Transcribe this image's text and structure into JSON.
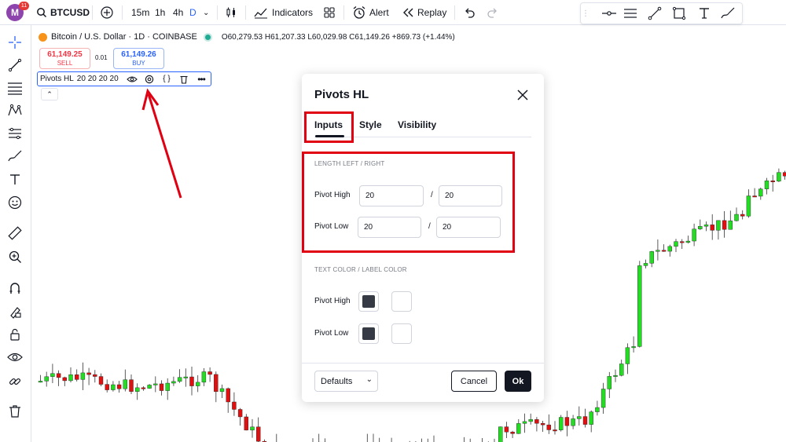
{
  "topbar": {
    "avatar_letter": "M",
    "notification_count": "11",
    "symbol": "BTCUSD",
    "intervals": [
      "15m",
      "1h",
      "4h",
      "D"
    ],
    "active_interval": "D",
    "indicators_label": "Indicators",
    "alert_label": "Alert",
    "replay_label": "Replay"
  },
  "legend": {
    "title": "Bitcoin / U.S. Dollar · 1D · COINBASE",
    "ohlc": "O60,279.53 H61,207.33 L60,029.98 C61,149.26 +869.73 (+1.44%)"
  },
  "trade": {
    "sell_price": "61,149.25",
    "sell_label": "SELL",
    "spread": "0.01",
    "buy_price": "61,149.26",
    "buy_label": "BUY"
  },
  "indicator": {
    "name": "Pivots HL",
    "args": "20 20 20 20"
  },
  "dialog": {
    "title": "Pivots HL",
    "tabs": [
      "Inputs",
      "Style",
      "Visibility"
    ],
    "active_tab": "Inputs",
    "length_section": "LENGTH LEFT / RIGHT",
    "pivot_high_label": "Pivot High",
    "pivot_high_left": "20",
    "pivot_high_right": "20",
    "pivot_low_label": "Pivot Low",
    "pivot_low_left": "20",
    "pivot_low_right": "20",
    "separator": "/",
    "color_section": "TEXT COLOR / LABEL COLOR",
    "color_high_label": "Pivot High",
    "color_low_label": "Pivot Low",
    "text_color": "#363a45",
    "label_color": "#ffffff",
    "defaults_label": "Defaults",
    "cancel_label": "Cancel",
    "ok_label": "Ok"
  },
  "colors": {
    "up": "#22dd22",
    "down": "#e01010",
    "annotation": "#e00012"
  },
  "icons": [
    "plus-circle-icon",
    "candles-icon",
    "indicators-icon",
    "templates-icon",
    "alert-icon",
    "replay-icon",
    "undo-icon",
    "redo-icon",
    "crosshair-icon",
    "trendline-icon",
    "fib-icon",
    "pattern-icon",
    "measure-icon",
    "zoom-icon",
    "magnet-icon",
    "lock-icon",
    "eye-icon",
    "link-icon",
    "trash-icon",
    "gear-icon",
    "close-icon",
    "chevron-down-icon"
  ]
}
